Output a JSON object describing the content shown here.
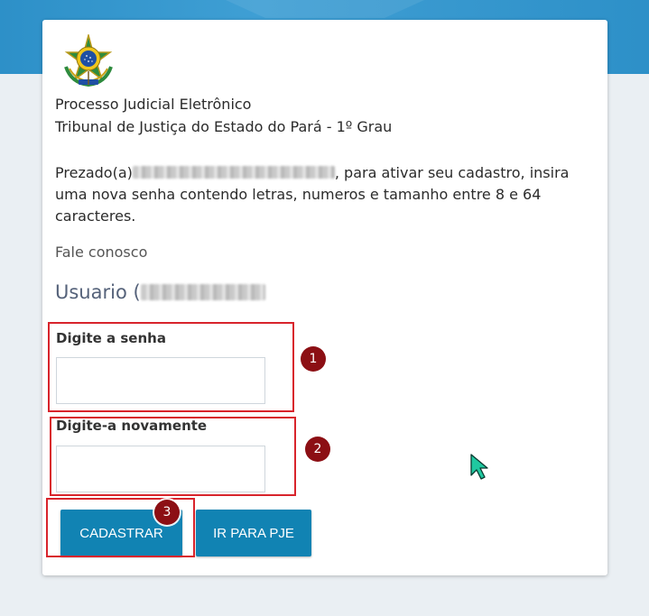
{
  "header": {
    "system_name": "Processo Judicial Eletrônico",
    "court_name": "Tribunal de Justiça do Estado do Pará - 1º Grau"
  },
  "message": {
    "greeting": "Prezado(a)",
    "text": ", para ativar seu cadastro, insira uma nova senha contendo letras, numeros e tamanho entre 8 e 64 caracteres."
  },
  "contact": {
    "label": "Fale conosco"
  },
  "user": {
    "label": "Usuario ("
  },
  "form": {
    "password_label": "Digite a senha",
    "password_value": "",
    "confirm_label": "Digite-a novamente",
    "confirm_value": ""
  },
  "buttons": {
    "register_label": "CADASTRAR",
    "pje_label": "IR PARA PJE"
  },
  "annotations": {
    "step1": "1",
    "step2": "2",
    "step3": "3"
  },
  "colors": {
    "top_band": "#2d90c8",
    "button": "#1183b3",
    "highlight": "#d8242c",
    "badge": "#8c0f14"
  }
}
